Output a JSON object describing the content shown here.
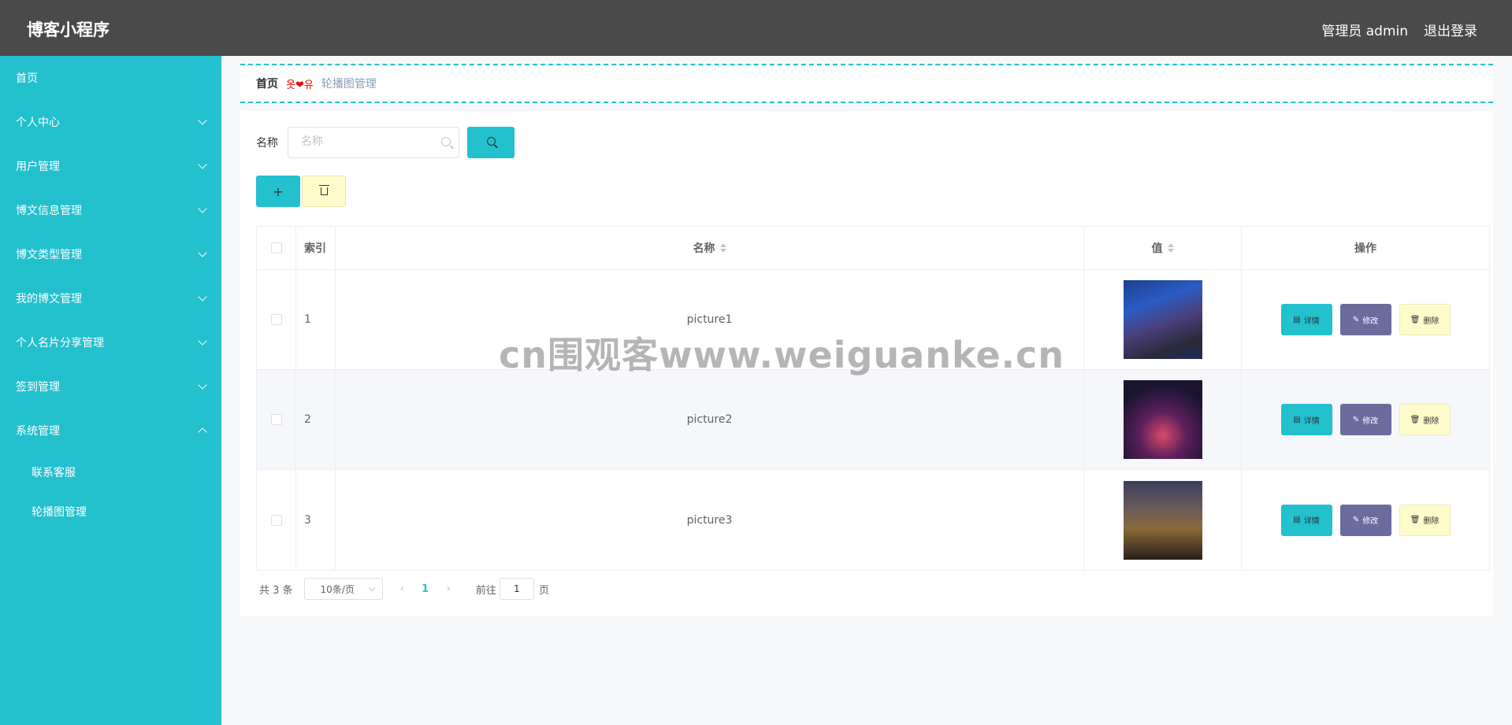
{
  "header": {
    "title": "博客小程序",
    "admin_label": "管理员 admin",
    "logout_label": "退出登录"
  },
  "sidebar": {
    "items": [
      {
        "label": "首页",
        "has_arrow": false
      },
      {
        "label": "个人中心",
        "has_arrow": true
      },
      {
        "label": "用户管理",
        "has_arrow": true
      },
      {
        "label": "博文信息管理",
        "has_arrow": true
      },
      {
        "label": "博文类型管理",
        "has_arrow": true
      },
      {
        "label": "我的博文管理",
        "has_arrow": true
      },
      {
        "label": "个人名片分享管理",
        "has_arrow": true
      },
      {
        "label": "签到管理",
        "has_arrow": true
      },
      {
        "label": "系统管理",
        "has_arrow": true,
        "expanded": true
      }
    ],
    "sub_items": [
      {
        "label": "联系客服"
      },
      {
        "label": "轮播图管理"
      }
    ]
  },
  "breadcrumb": {
    "home": "首页",
    "separator": "옷❤유",
    "current": "轮播图管理"
  },
  "search": {
    "label": "名称",
    "placeholder": "名称"
  },
  "table": {
    "headers": {
      "index": "索引",
      "name": "名称",
      "value": "值",
      "actions": "操作"
    },
    "rows": [
      {
        "index": "1",
        "name": "picture1"
      },
      {
        "index": "2",
        "name": "picture2"
      },
      {
        "index": "3",
        "name": "picture3"
      }
    ],
    "actions": {
      "detail": "详情",
      "edit": "修改",
      "delete": "删除"
    }
  },
  "pagination": {
    "total": "共 3 条",
    "page_size": "10条/页",
    "current_page": "1",
    "goto_label": "前往",
    "goto_value": "1",
    "page_suffix": "页"
  },
  "watermark": "cn围观客www.weiguanke.cn",
  "colors": {
    "accent": "#23c0ce",
    "header_bg": "#4a4a4a",
    "edit_button": "#6b6b9e",
    "delete_button": "#fdfcca"
  }
}
